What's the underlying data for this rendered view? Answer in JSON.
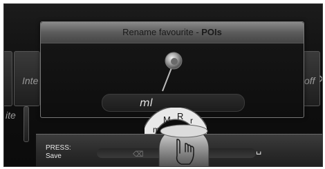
{
  "dialog": {
    "title_prefix": "Rename favourite - ",
    "title_bold": "POIs"
  },
  "input": {
    "value": "ml"
  },
  "background": {
    "left_label": "Inte",
    "left_label2": "ite",
    "right_label": "off",
    "next_arrow": "›"
  },
  "speller": {
    "letters": [
      "m",
      "M",
      "R",
      "r",
      "n"
    ]
  },
  "footer": {
    "press_label": "PRESS:",
    "press_action": "Save",
    "delete_symbol": "⌫",
    "space_symbol": "␣"
  },
  "icons": {
    "pin": "map-pin-icon",
    "controller": "hand-touch-controller-icon"
  }
}
